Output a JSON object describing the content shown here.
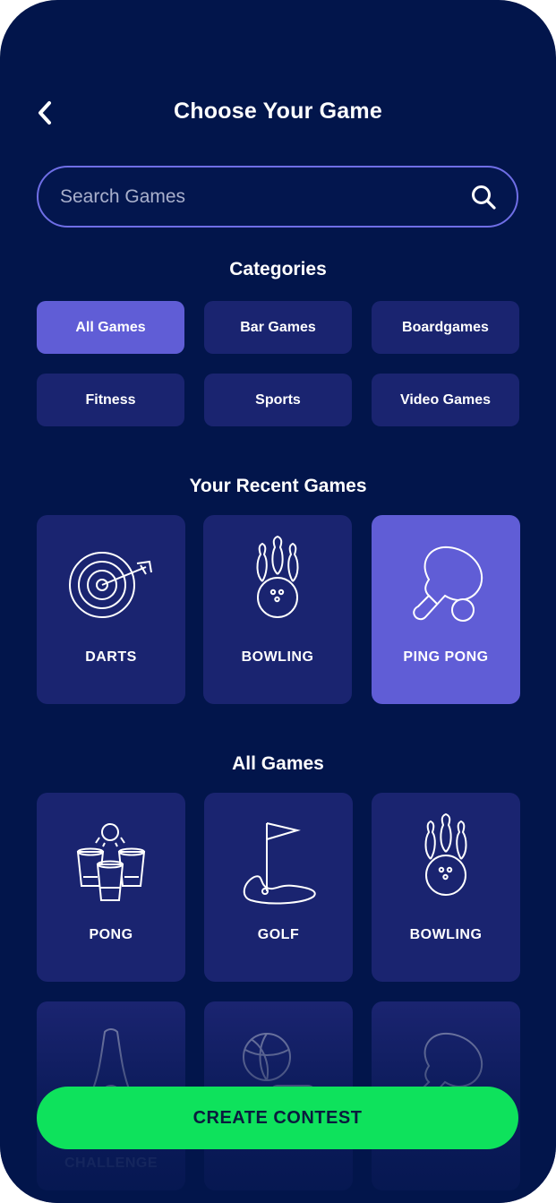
{
  "header": {
    "title": "Choose Your Game",
    "back_icon": "chevron-left-icon"
  },
  "search": {
    "placeholder": "Search Games",
    "value": "",
    "icon": "search-icon"
  },
  "categories": {
    "title": "Categories",
    "items": [
      {
        "label": "All Games",
        "selected": true
      },
      {
        "label": "Bar Games",
        "selected": false
      },
      {
        "label": "Boardgames",
        "selected": false
      },
      {
        "label": "Fitness",
        "selected": false
      },
      {
        "label": "Sports",
        "selected": false
      },
      {
        "label": "Video Games",
        "selected": false
      }
    ]
  },
  "recent": {
    "title": "Your Recent Games",
    "items": [
      {
        "label": "DARTS",
        "icon": "dartboard-icon",
        "selected": false
      },
      {
        "label": "BOWLING",
        "icon": "bowling-icon",
        "selected": false
      },
      {
        "label": "PING PONG",
        "icon": "ping-pong-paddle-icon",
        "selected": true
      }
    ]
  },
  "all_games": {
    "title": "All Games",
    "items": [
      {
        "label": "PONG",
        "icon": "beer-pong-cups-icon"
      },
      {
        "label": "GOLF",
        "icon": "golf-flag-icon"
      },
      {
        "label": "BOWLING",
        "icon": "bowling-icon"
      },
      {
        "label": "CHALLENGE",
        "icon": "challenge-icon"
      },
      {
        "label": "",
        "icon": "basketball-controller-icon"
      },
      {
        "label": "",
        "icon": "ping-pong-paddle-icon"
      }
    ]
  },
  "cta": {
    "label": "CREATE CONTEST"
  },
  "colors": {
    "background": "#02154b",
    "card": "#1a2470",
    "accent": "#605dd6",
    "search_border": "#6f6ee6",
    "cta": "#0ee25c",
    "cta_text": "#0a1b3d"
  }
}
